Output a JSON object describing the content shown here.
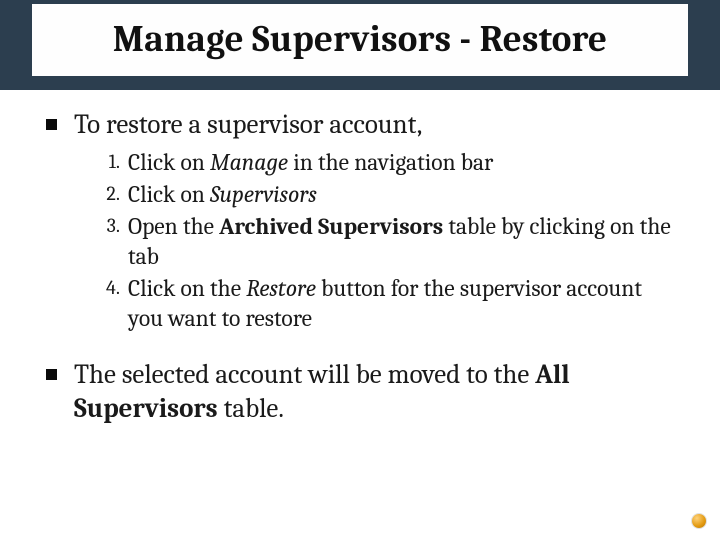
{
  "title": "Manage Supervisors - Restore",
  "bullets": {
    "intro": "To restore a supervisor account,",
    "outro_pre": "The selected account will be moved to the ",
    "outro_bold": "All Supervisors",
    "outro_post": " table."
  },
  "steps": {
    "s1_pre": "Click on ",
    "s1_em": "Manage",
    "s1_post": " in the navigation bar",
    "s2_pre": "Click on ",
    "s2_em": "Supervisors",
    "s3_pre": "Open the ",
    "s3_bold": "Archived Supervisors",
    "s3_post": " table by clicking on the tab",
    "s4_pre": "Click on the ",
    "s4_em": "Restore",
    "s4_post": " button for the supervisor account you want to restore"
  }
}
